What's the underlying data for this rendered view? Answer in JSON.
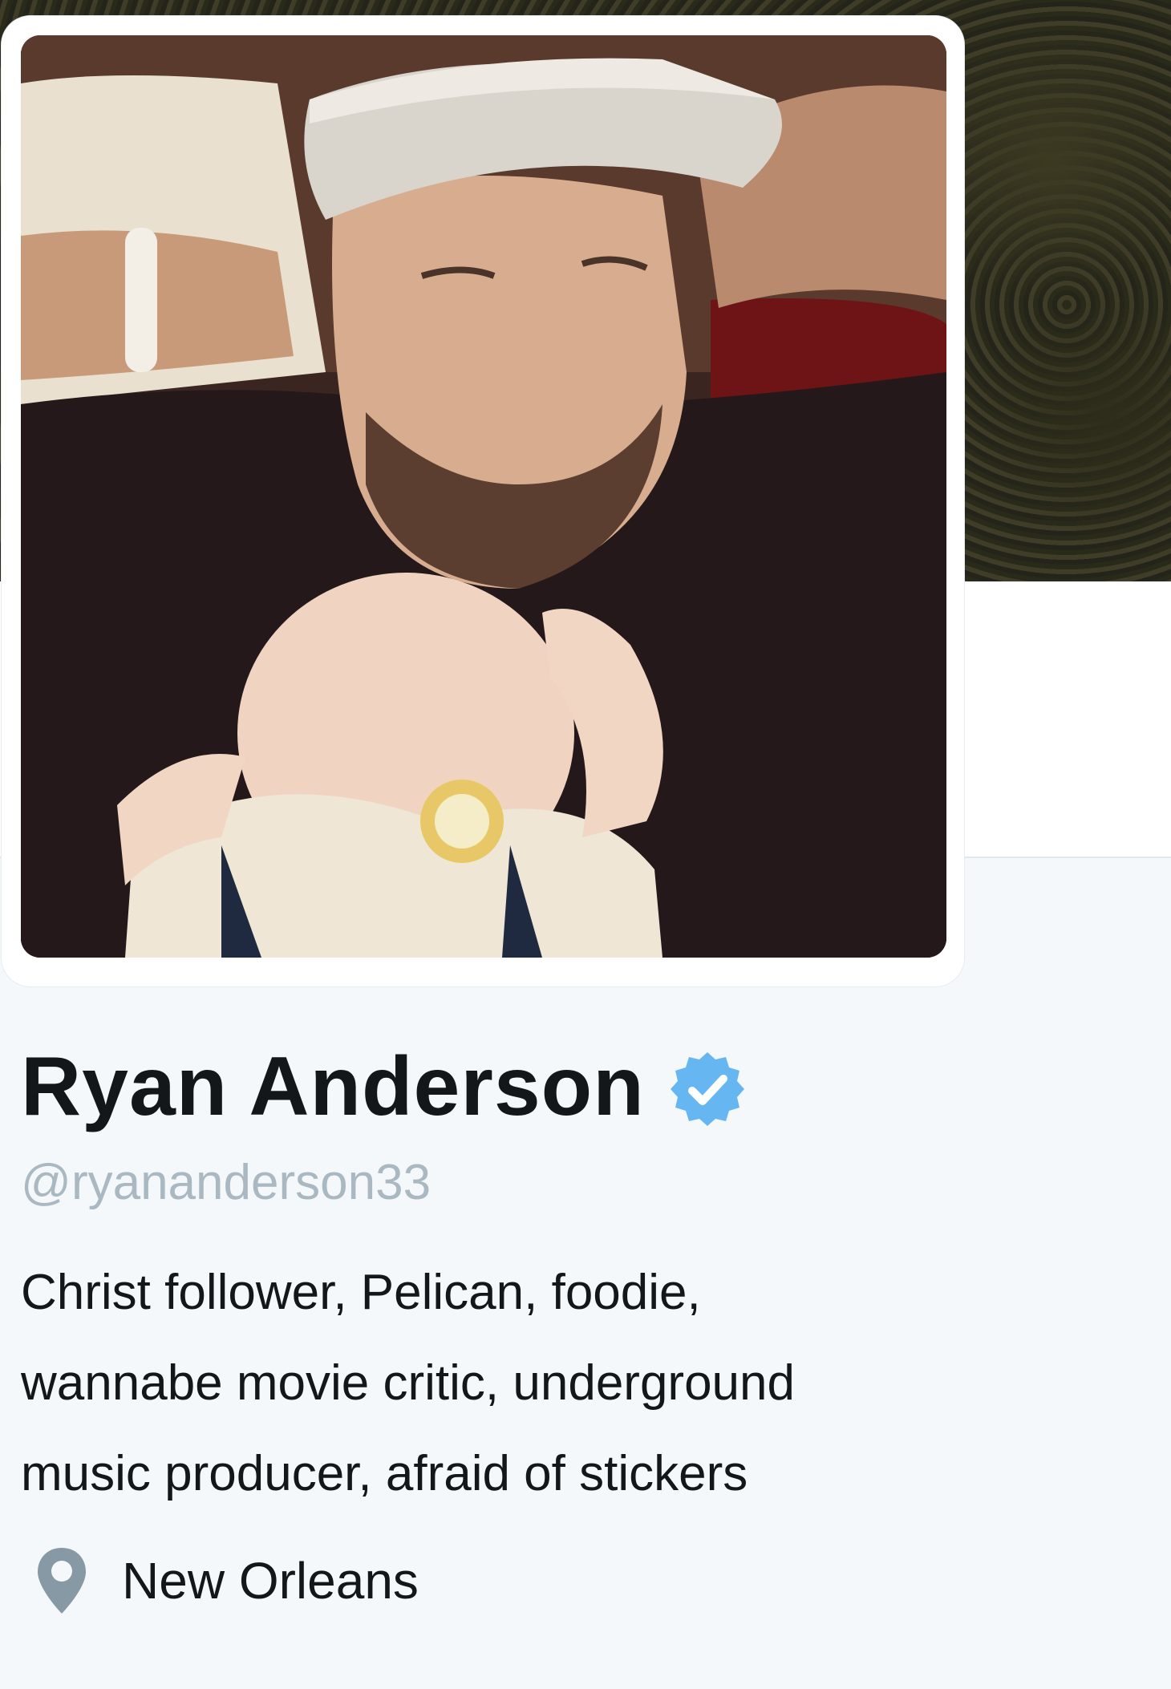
{
  "profile": {
    "display_name": "Ryan Anderson",
    "verified": true,
    "screen_name": "@ryananderson33",
    "bio_lines": [
      "Christ follower, Pelican, foodie,",
      "wannabe movie critic, underground",
      "music producer, afraid of stickers"
    ],
    "location": "New Orleans"
  },
  "icons": {
    "verified": "verified-badge-icon",
    "location": "location-pin-icon"
  },
  "colors": {
    "verified_blue": "#1da1f2",
    "name_text": "#14171a",
    "muted_text": "#aab8c2",
    "background": "#f5f8fa"
  }
}
